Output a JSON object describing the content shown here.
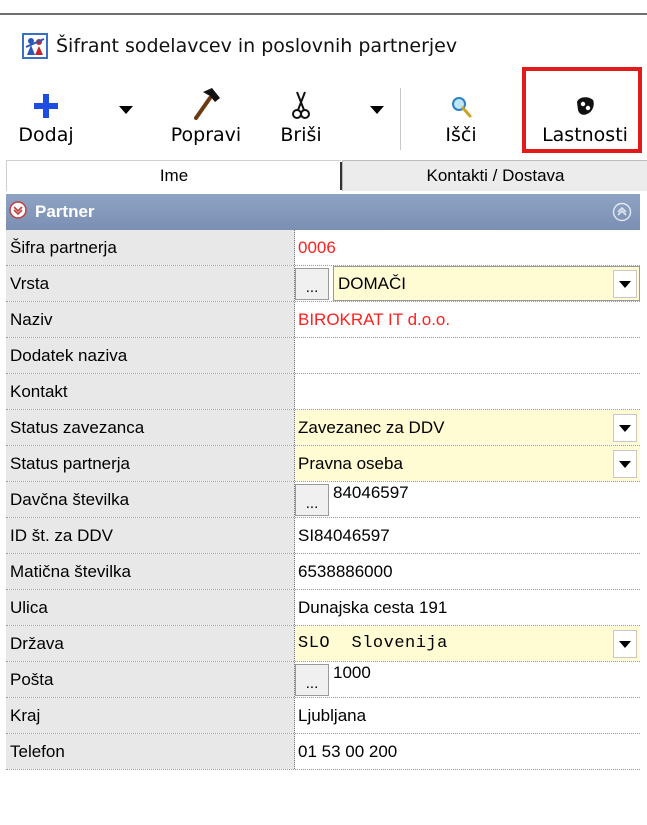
{
  "window": {
    "title": "Šifrant sodelavcev in poslovnih partnerjev"
  },
  "toolbar": {
    "add_label": "Dodaj",
    "edit_label": "Popravi",
    "delete_label": "Briši",
    "search_label": "Išči",
    "properties_label": "Lastnosti",
    "highlight_color": "#e21a1a"
  },
  "tabs": {
    "name": "Ime",
    "contacts": "Kontakti / Dostava"
  },
  "section": {
    "title": "Partner",
    "header_color": "#7a8fb3"
  },
  "fields": {
    "partner_code": {
      "label": "Šifra partnerja",
      "value": "0006"
    },
    "type": {
      "label": "Vrsta",
      "value": "DOMAČI"
    },
    "name": {
      "label": "Naziv",
      "value": "BIROKRAT IT d.o.o."
    },
    "name_addon": {
      "label": "Dodatek naziva",
      "value": ""
    },
    "contact": {
      "label": "Kontakt",
      "value": ""
    },
    "taxpayer_status": {
      "label": "Status zavezanca",
      "value": "Zavezanec za DDV"
    },
    "partner_status": {
      "label": "Status partnerja",
      "value": "Pravna oseba"
    },
    "tax_number": {
      "label": "Davčna številka",
      "value": "84046597"
    },
    "vat_id": {
      "label": "ID št. za DDV",
      "value": "SI84046597"
    },
    "registration_number": {
      "label": "Matična številka",
      "value": "6538886000"
    },
    "street": {
      "label": "Ulica",
      "value": "Dunajska cesta 191"
    },
    "country": {
      "label": "Država",
      "code": "SLO",
      "name": "Slovenija"
    },
    "post": {
      "label": "Pošta",
      "value": "1000"
    },
    "city": {
      "label": "Kraj",
      "value": "Ljubljana"
    },
    "phone": {
      "label": "Telefon",
      "value": "01 53 00 200"
    }
  },
  "ellipsis": "..."
}
